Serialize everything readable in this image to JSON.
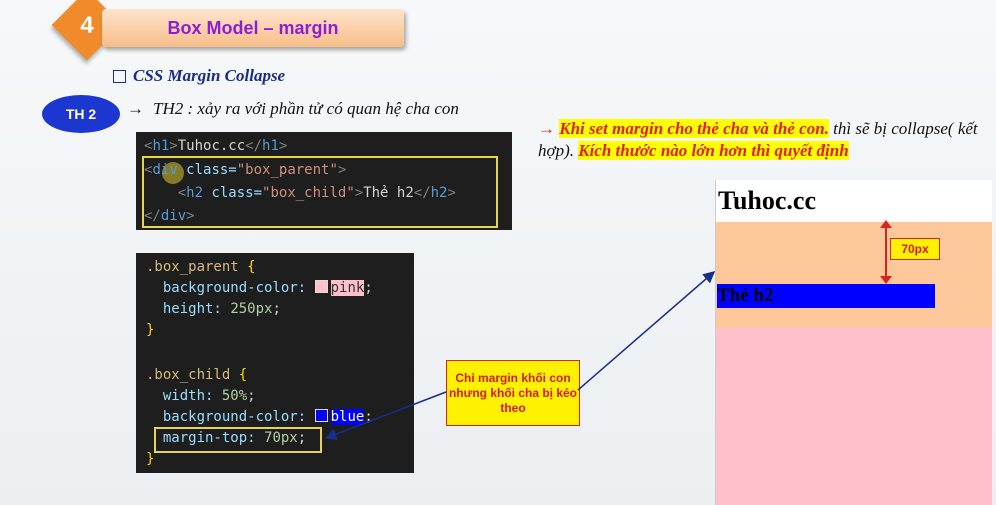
{
  "header": {
    "number": "4",
    "title": "Box Model – margin"
  },
  "section": {
    "title": "CSS Margin Collapse"
  },
  "case": {
    "badge": "TH 2",
    "arrow": "→",
    "description": "TH2 : xảy ra với  phần tử có quan hệ cha con"
  },
  "html_code": [
    {
      "indent": "",
      "parts": [
        "<h1>",
        "Tuhoc.cc",
        "</h1>"
      ]
    },
    {
      "indent": "",
      "parts": [
        "<div",
        " class=",
        "\"box_parent\"",
        ">"
      ]
    },
    {
      "indent": "    ",
      "parts": [
        "<h2",
        " class=",
        "\"box_child\"",
        ">",
        "Thẻ h2",
        "</h2>"
      ]
    },
    {
      "indent": "",
      "parts": [
        "</div>"
      ]
    }
  ],
  "css_code": {
    "parent_selector": ".box_parent",
    "open_brace": "{",
    "close_brace": "}",
    "parent_bg_prop": "background-color:",
    "parent_bg_value": "pink",
    "parent_height_prop": "height:",
    "parent_height_value": "250px",
    "child_selector": ".box_child",
    "child_width_prop": "width:",
    "child_width_value": "50%",
    "child_bg_prop": "background-color:",
    "child_bg_value": "blue",
    "child_margin_prop": "margin-top:",
    "child_margin_value": "70px",
    "semicolon": ";"
  },
  "callout": {
    "text": "Chỉ margin khối con nhưng khối cha bị kéo theo"
  },
  "note": {
    "arrow": "→",
    "part1": "Khi set margin cho thẻ cha và thẻ con.",
    "part2": " thì sẽ bị collapse( kết hợp). ",
    "part3": "Kích thước nào lớn hơn thì quyết định"
  },
  "preview": {
    "h1": "Tuhoc.cc",
    "h2": "Thẻ h2",
    "margin_label": "70px"
  },
  "colors": {
    "accent_orange": "#f08a2a",
    "title_purple": "#8a1fd6",
    "oval_blue": "#1c36d0",
    "pink": "#ffc0cb",
    "blue": "#0000ff",
    "callout_yellow": "#fff200"
  }
}
